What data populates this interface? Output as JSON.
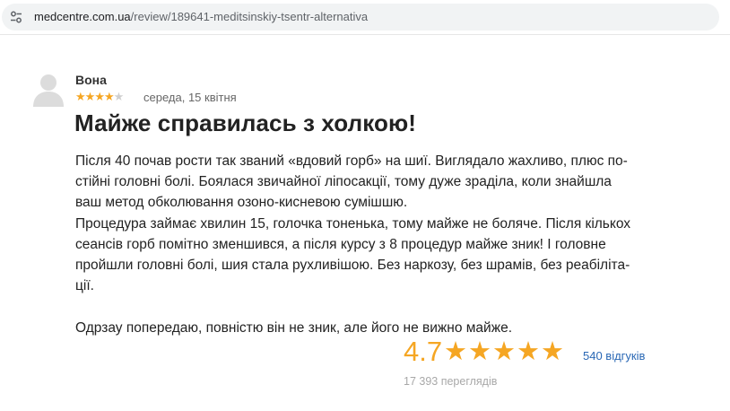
{
  "browser": {
    "url_domain": "medcentre.com.ua",
    "url_path": "/review/189641-meditsinskiy-tsentr-alternativa",
    "site_icon": "tune-icon"
  },
  "review": {
    "author": "Вона",
    "stars_filled": 4,
    "stars_total": 5,
    "date": "середа, 15 квітня",
    "title": "Майже справилась з холкою!",
    "lines": [
      "Після 40 почав рости так званий «вдовий горб» на шиї. Виглядало жахливо, плюс по-",
      "стійні головні болі. Боялася звичайної ліпосакції, тому дуже зраділа, коли знайшла",
      "ваш метод обколювання озоно-кисневою сумішшю.",
      "Процедура займає хвилин 15, голочка тоненька, тому майже не боляче. Після кількох",
      "сеансів горб помітно зменшився, а після курсу з 8 процедур майже зник! І головне",
      "пройшли головні болі, шия стала рухливішою. Без наркозу, без шрамів, без реабіліта-",
      "ції.",
      "",
      "Одрзау попередаю, повністю він не зник, але його не вижно майже."
    ]
  },
  "summary": {
    "rating": "4.7",
    "stars": "★★★★★",
    "reviews_link": "540 відгуків",
    "views": "17 393 переглядів"
  },
  "colors": {
    "star": "#f5a623",
    "star_off": "#cfcfcf",
    "link": "#2a68b5",
    "muted": "#a8a8a8"
  }
}
